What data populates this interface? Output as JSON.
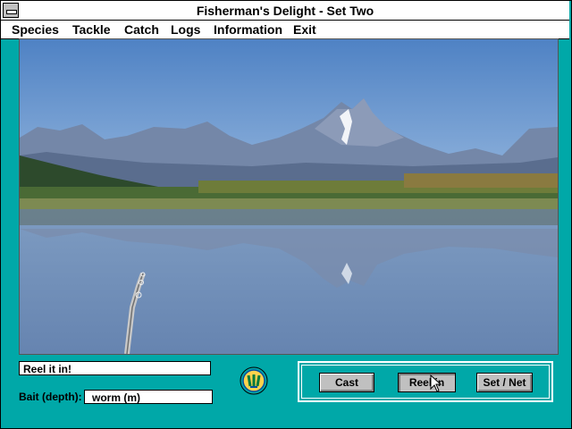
{
  "window": {
    "title": "Fisherman's Delight - Set Two"
  },
  "menu": [
    "Species",
    "Tackle",
    "Catch",
    "Logs",
    "Information",
    "Exit"
  ],
  "status": {
    "message": "Reel it in!"
  },
  "bait": {
    "label": "Bait (depth):",
    "value": "worm (m)"
  },
  "buttons": {
    "cast": "Cast",
    "reel_in": "Reel in",
    "set_net": "Set / Net"
  },
  "colors": {
    "background": "#00a8a8",
    "sky": "#5e8fcb",
    "water": "#6f8fb8"
  },
  "icons": {
    "logo": "fish-emblem-icon",
    "system": "system-menu-icon",
    "cursor": "arrow-cursor-icon"
  }
}
